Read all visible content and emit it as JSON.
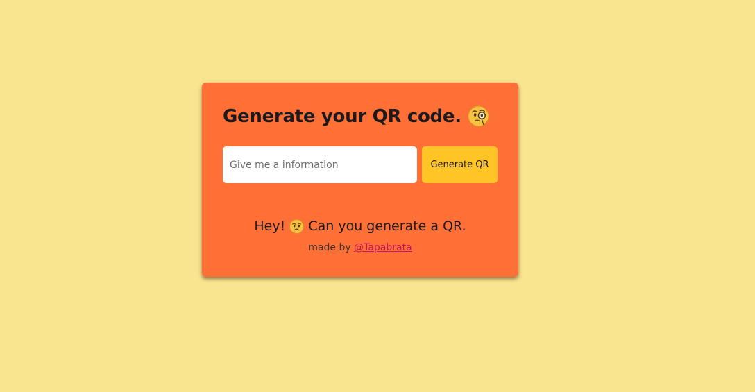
{
  "card": {
    "title": "Generate your QR code.",
    "title_icon": "monocle-face-icon"
  },
  "form": {
    "input_value": "",
    "input_placeholder": "Give me a information",
    "button_label": "Generate QR"
  },
  "message": {
    "greeting": "Hey!",
    "greeting_icon": "worried-face-icon",
    "text": "Can you generate a QR."
  },
  "credit": {
    "prefix": "made by",
    "author_link": "@Tapabrata"
  },
  "colors": {
    "background": "#f9e590",
    "card": "#ff7036",
    "button": "#ffc526",
    "link": "#c1155c",
    "text": "#1d1a1f"
  }
}
